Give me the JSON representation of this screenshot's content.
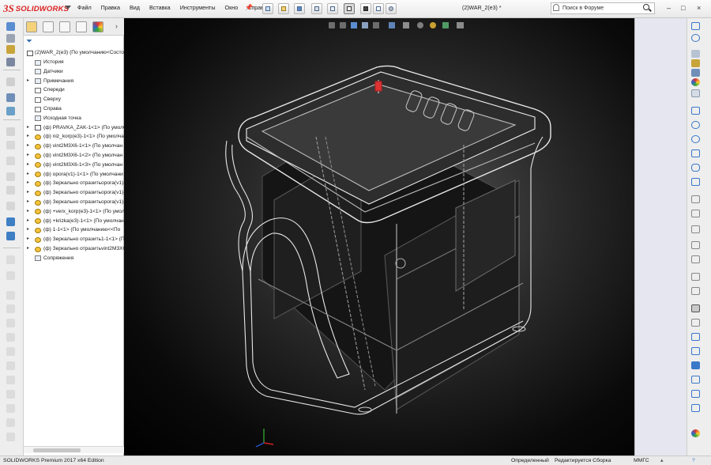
{
  "app": {
    "logo_ds": "3S",
    "logo_text": "SOLIDWORKS",
    "document_title": "(2)WAR_2(e3) *"
  },
  "menu": [
    "Файл",
    "Правка",
    "Вид",
    "Вставка",
    "Инструменты",
    "Окно",
    "Справка"
  ],
  "search": {
    "placeholder": "Поиск в Форуме"
  },
  "window_controls": [
    "–",
    "□",
    "×"
  ],
  "feature_tree": {
    "root": "(2)WAR_2(e3)  (По умолчанию<Состо",
    "items": [
      {
        "label": "История",
        "icon": "history-icon"
      },
      {
        "label": "Датчики",
        "icon": "sensors-icon"
      },
      {
        "label": "Примечания",
        "icon": "annotations-icon"
      },
      {
        "label": "Спереди",
        "icon": "plane-icon"
      },
      {
        "label": "Сверху",
        "icon": "plane-icon"
      },
      {
        "label": "Справа",
        "icon": "plane-icon"
      },
      {
        "label": "Исходная точка",
        "icon": "origin-icon"
      },
      {
        "label": "(ф) PRAVKA_ZAK-1<1> (По умолч",
        "icon": "assembly-icon"
      },
      {
        "label": "(ф) niz_korp(e3)-1<1> (По умолча",
        "icon": "part-icon"
      },
      {
        "label": "(ф) vint2M3X6-1<1> (По умолчан",
        "icon": "part-icon"
      },
      {
        "label": "(ф) vint2M3X6-1<2> (По умолчан",
        "icon": "part-icon"
      },
      {
        "label": "(ф) vint2M3X6-1<3> (По умолчан",
        "icon": "part-icon"
      },
      {
        "label": "(ф) opora(v1)-1<1> (По умолчани",
        "icon": "part-icon"
      },
      {
        "label": "(ф) Зеркально отразитьopora(v1)-",
        "icon": "part-icon"
      },
      {
        "label": "(ф) Зеркально отразитьopora(v1)-",
        "icon": "part-icon"
      },
      {
        "label": "(ф) Зеркально отразитьopora(v1)-",
        "icon": "part-icon"
      },
      {
        "label": "(ф) +verx_korp(e3)-1<1> (По умол",
        "icon": "part-icon"
      },
      {
        "label": "(ф) +krizka(e3)-1<1> (По умолчан",
        "icon": "part-icon"
      },
      {
        "label": "(ф) 1-1<1> (По умолчанию<<По",
        "icon": "part-icon"
      },
      {
        "label": "(ф) Зеркально отразить1-1<1> (П",
        "icon": "part-icon"
      },
      {
        "label": "(ф) Зеркально отразитьvint2M3X6",
        "icon": "part-icon"
      },
      {
        "label": "Сопряжения",
        "icon": "mates-icon"
      }
    ]
  },
  "status": {
    "product": "SOLIDWORKS Premium 2017 x64 Edition",
    "state": "Определенный",
    "editing": "Редактируется Сборка",
    "units": "ММГС"
  },
  "colors": {
    "accent": "#2b6fc4",
    "brand": "#d22222",
    "viewport": "#000000"
  }
}
